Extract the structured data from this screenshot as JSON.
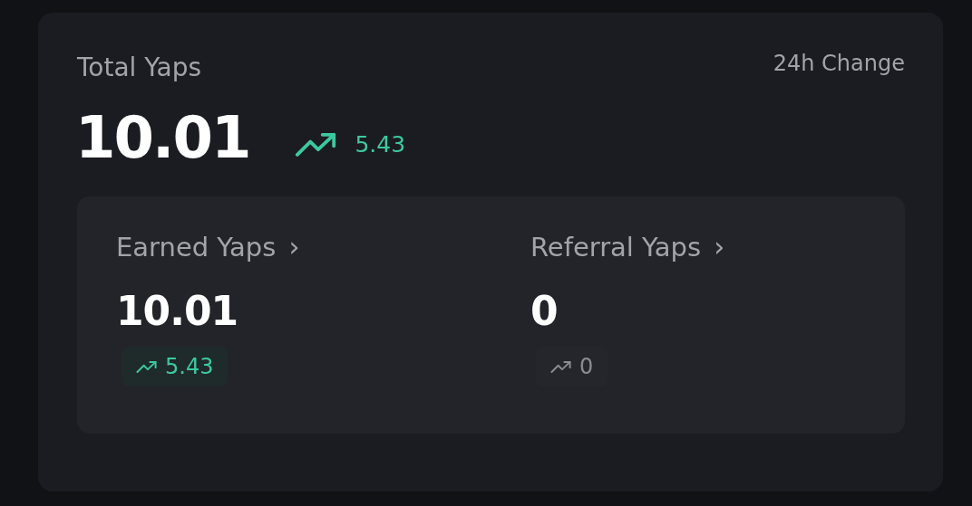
{
  "total": {
    "label": "Total Yaps",
    "change_label": "24h Change",
    "value": "10.01",
    "change": {
      "value": "5.43",
      "positive": true
    }
  },
  "breakdown": [
    {
      "label": "Earned Yaps",
      "chevron": "›",
      "value": "10.01",
      "change": {
        "value": "5.43",
        "positive": true
      }
    },
    {
      "label": "Referral Yaps",
      "chevron": "›",
      "value": "0",
      "change": {
        "value": "0",
        "positive": false
      }
    }
  ]
}
